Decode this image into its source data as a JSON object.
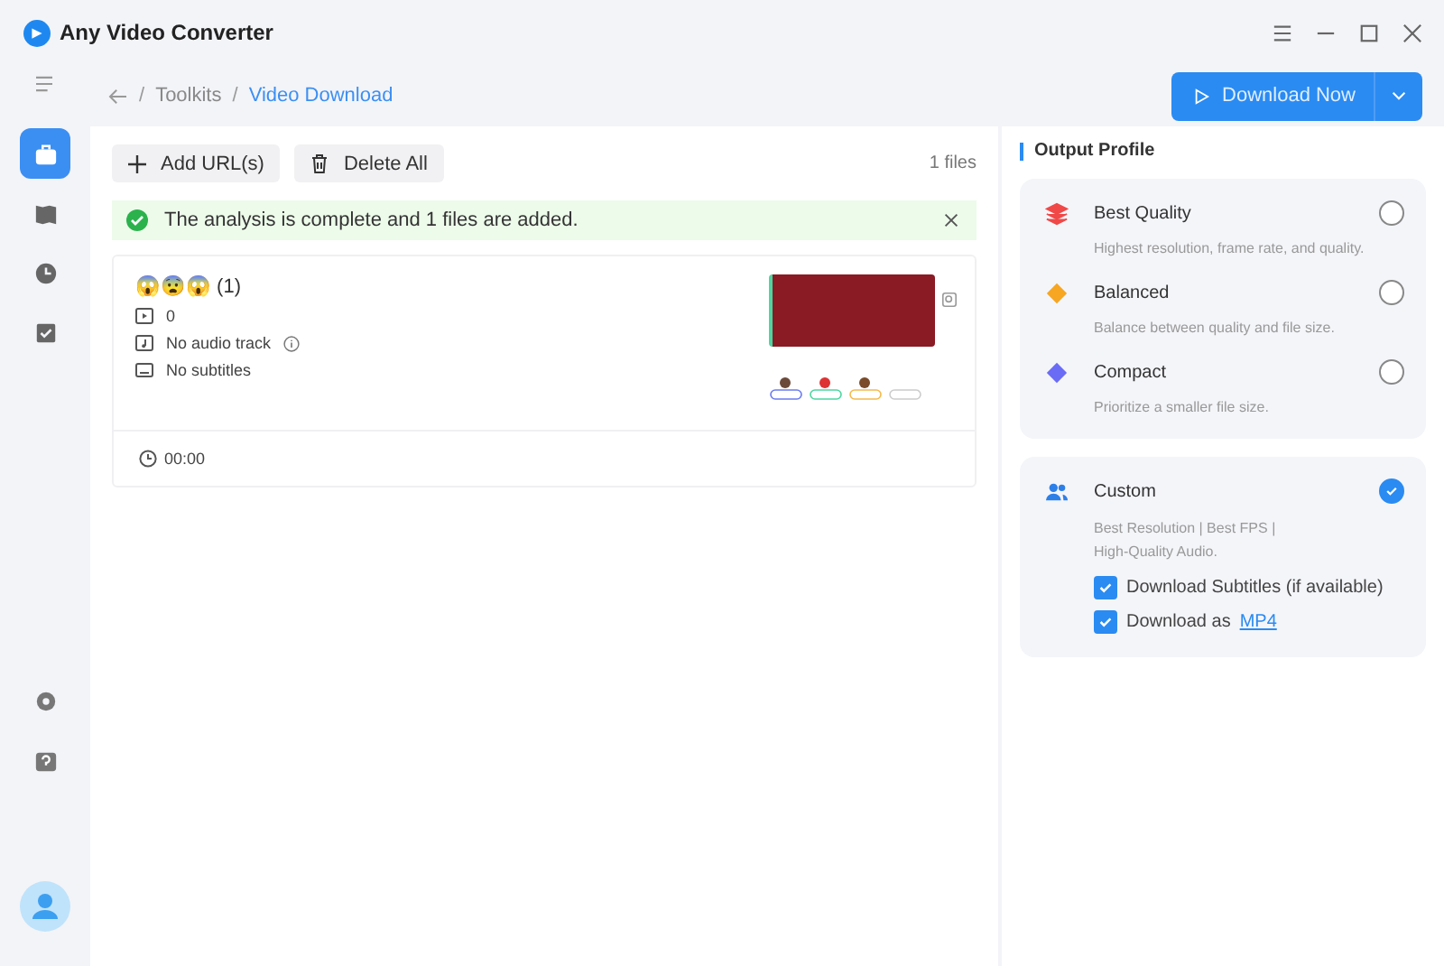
{
  "window": {
    "title": "Any Video Converter"
  },
  "breadcrumb": [
    "Toolkits",
    "Video Download"
  ],
  "breadcrumb_separator": "/",
  "download_button": {
    "label": "Download Now"
  },
  "toolbar": {
    "buttons": [
      "Add URL(s)",
      "Delete All"
    ],
    "file_count": "1 files"
  },
  "notice": {
    "text": "The analysis is complete and 1 files are added."
  },
  "sidebar": {
    "items": [
      {
        "kind": "toolkit",
        "selected": true
      },
      {
        "kind": "library",
        "selected": false
      },
      {
        "kind": "history",
        "selected": false
      },
      {
        "kind": "tasks",
        "selected": false
      }
    ]
  },
  "file": {
    "title": "😱😨😱 (1)",
    "video": "0",
    "audio": "No audio track",
    "subtitles": "No subtitles",
    "duration": "00:00"
  },
  "output_profile": {
    "title": "Output Profile",
    "profiles": [
      {
        "kind": "layers",
        "color": "#f04848",
        "name": "Best Quality",
        "description": "Highest resolution, frame rate, and quality.",
        "selected": false
      },
      {
        "kind": "diamond",
        "color": "#f6a623",
        "name": "Balanced",
        "description": "Balance between quality and file size.",
        "selected": false
      },
      {
        "kind": "diamond",
        "color": "#6a6cf6",
        "name": "Compact",
        "description": "Prioritize a smaller file size.",
        "selected": false
      },
      {
        "kind": "people",
        "color": "#2d7fe8",
        "name": "Custom",
        "description": "Best Resolution | Best FPS | High-Quality Audio.",
        "selected": true,
        "options": [
          {
            "label": "Download Subtitles (if available)",
            "checked": true
          },
          {
            "label": "Download as",
            "link": "MP4",
            "checked": true
          }
        ]
      }
    ]
  }
}
